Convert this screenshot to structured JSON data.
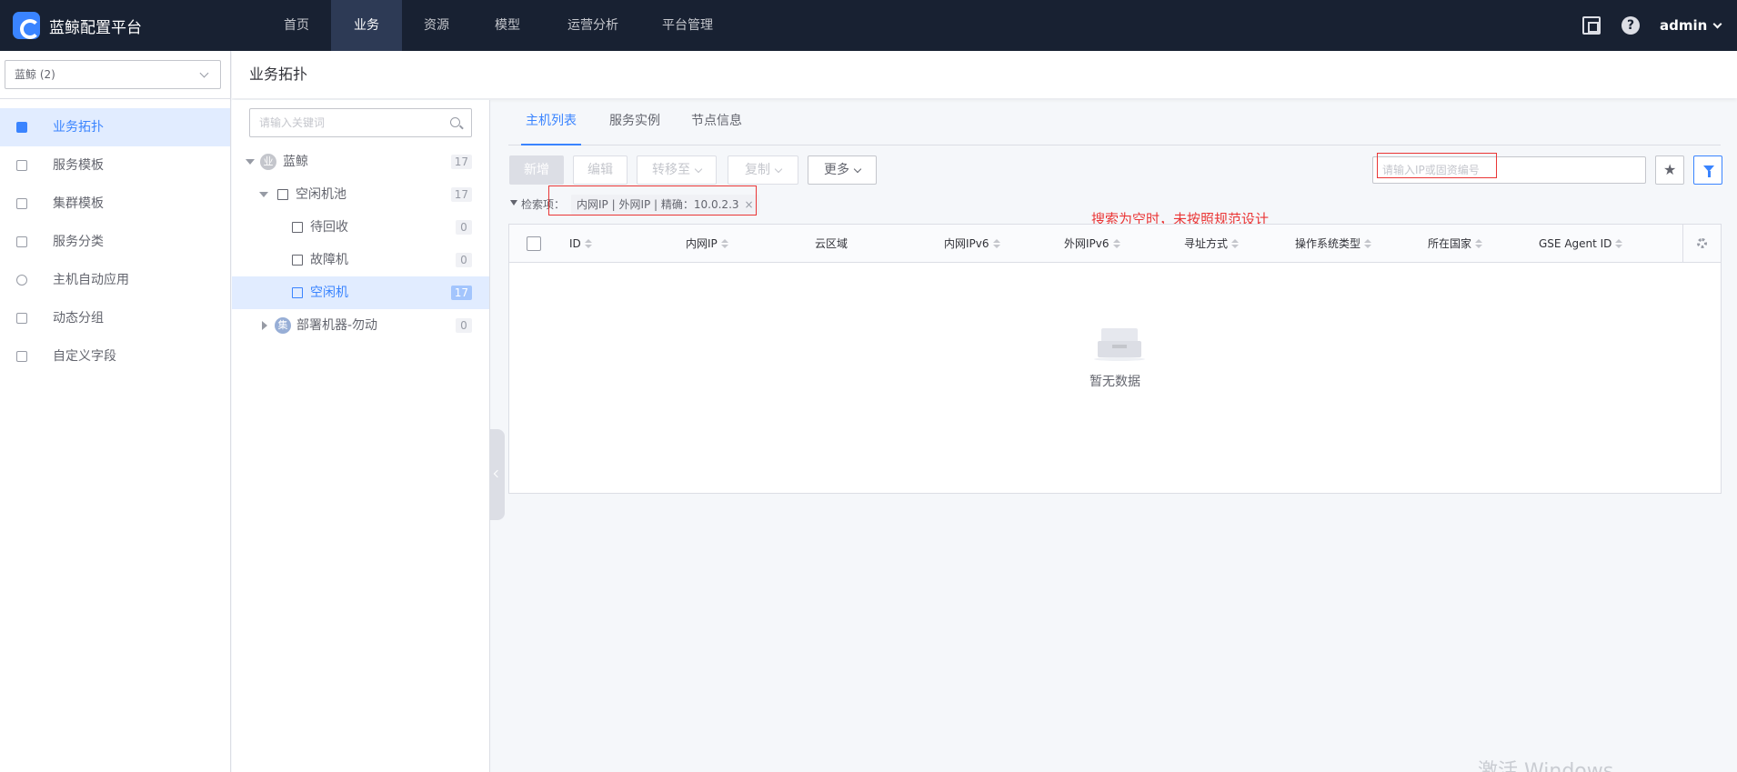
{
  "app": {
    "title": "蓝鲸配置平台"
  },
  "nav": {
    "items": [
      {
        "label": "首页"
      },
      {
        "label": "业务"
      },
      {
        "label": "资源"
      },
      {
        "label": "模型"
      },
      {
        "label": "运营分析"
      },
      {
        "label": "平台管理"
      }
    ],
    "active": "业务",
    "user": "admin"
  },
  "sidebar": {
    "business_select": "蓝鲸 (2)",
    "items": [
      {
        "label": "业务拓扑",
        "active": true
      },
      {
        "label": "服务模板"
      },
      {
        "label": "集群模板"
      },
      {
        "label": "服务分类"
      },
      {
        "label": "主机自动应用"
      },
      {
        "label": "动态分组"
      },
      {
        "label": "自定义字段"
      }
    ]
  },
  "page": {
    "title": "业务拓扑"
  },
  "tree": {
    "search_placeholder": "请输入关键词",
    "nodes": [
      {
        "badge": "业",
        "label": "蓝鲸",
        "count": "17",
        "expanded": true
      },
      {
        "label": "空闲机池",
        "count": "17",
        "expanded": true
      },
      {
        "label": "待回收",
        "count": "0"
      },
      {
        "label": "故障机",
        "count": "0"
      },
      {
        "label": "空闲机",
        "count": "17",
        "active": true
      },
      {
        "badge": "集",
        "label": "部署机器-勿动",
        "count": "0",
        "expanded": false
      }
    ]
  },
  "tabs": [
    {
      "label": "主机列表",
      "active": true
    },
    {
      "label": "服务实例"
    },
    {
      "label": "节点信息"
    }
  ],
  "toolbar": {
    "add": "新增",
    "edit": "编辑",
    "transfer": "转移至",
    "copy": "复制",
    "more": "更多",
    "search_placeholder": "请输入IP或固资编号"
  },
  "filter": {
    "label": "检索项：",
    "tag": "内网IP | 外网IP | 精确：10.0.2.3",
    "close": "×"
  },
  "annotation": {
    "text": "搜索为空时，未按照规范设计"
  },
  "table": {
    "columns": [
      "ID",
      "内网IP",
      "云区域",
      "内网IPv6",
      "外网IPv6",
      "寻址方式",
      "操作系统类型",
      "所在国家",
      "GSE Agent ID"
    ],
    "empty_text": "暂无数据"
  },
  "watermark": "激活 Windows",
  "colors": {
    "nav_bg": "#182132",
    "accent": "#3a84ff",
    "annotation": "#ea3636"
  }
}
